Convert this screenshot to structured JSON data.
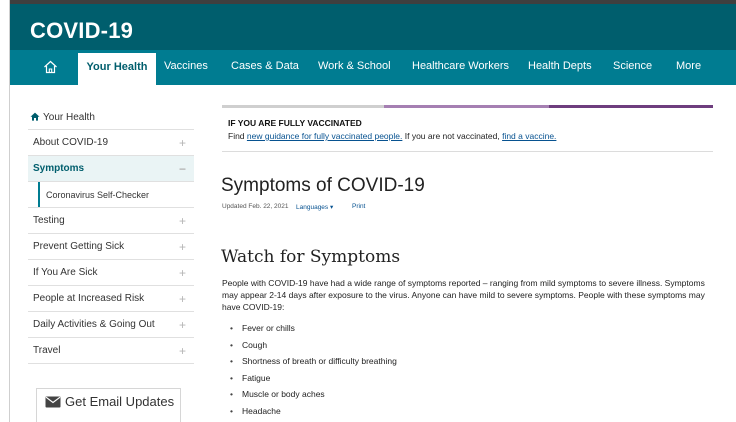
{
  "header": {
    "site_title": "COVID-19"
  },
  "nav": {
    "items": [
      {
        "label": "Your Health",
        "active": true
      },
      {
        "label": "Vaccines"
      },
      {
        "label": "Cases & Data"
      },
      {
        "label": "Work & School"
      },
      {
        "label": "Healthcare Workers"
      },
      {
        "label": "Health Depts"
      },
      {
        "label": "Science"
      },
      {
        "label": "More"
      }
    ]
  },
  "sidebar": {
    "heading": "Your Health",
    "items": [
      {
        "label": "About COVID-19",
        "expander": "+"
      },
      {
        "label": "Symptoms",
        "expander": "−",
        "active": true
      },
      {
        "label": "Coronavirus Self-Checker"
      },
      {
        "label": "Testing",
        "expander": "+"
      },
      {
        "label": "Prevent Getting Sick",
        "expander": "+"
      },
      {
        "label": "If You Are Sick",
        "expander": "+"
      },
      {
        "label": "People at Increased Risk",
        "expander": "+"
      },
      {
        "label": "Daily Activities & Going Out",
        "expander": "+"
      },
      {
        "label": "Travel",
        "expander": "+"
      }
    ],
    "email_label": "Get Email Updates"
  },
  "alert": {
    "title": "IF YOU ARE FULLY VACCINATED",
    "text_1": "Find ",
    "link_1": "new guidance for fully vaccinated people.",
    "text_2": " If you are not vaccinated, ",
    "link_2": "find a vaccine."
  },
  "main": {
    "title": "Symptoms of COVID-19",
    "updated": "Updated Feb. 22, 2021",
    "languages": "Languages ▾",
    "print": "Print",
    "section_title": "Watch for Symptoms",
    "intro": "People with COVID-19 have had a wide range of symptoms reported – ranging from mild symptoms to severe illness. Symptoms may appear 2-14 days after exposure to the virus. Anyone can have mild to severe symptoms. People with these symptoms may have COVID-19:",
    "symptoms": [
      "Fever or chills",
      "Cough",
      "Shortness of breath or difficulty breathing",
      "Fatigue",
      "Muscle or body aches",
      "Headache"
    ]
  },
  "colors": {
    "header": "#005e6d",
    "nav": "#007c91",
    "link": "#075290",
    "accent_purple": "#6e3d7e"
  }
}
